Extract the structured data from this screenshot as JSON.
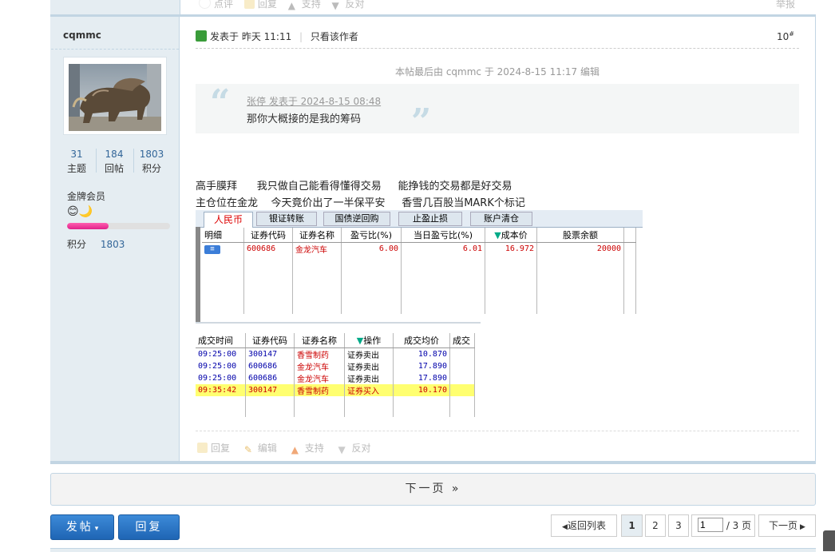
{
  "prev_post": {
    "actions": [
      "点评",
      "回复",
      "支持",
      "反对"
    ],
    "report": "举报"
  },
  "user": {
    "name": "cqmmc",
    "stats": [
      {
        "value": "31",
        "label": "主题"
      },
      {
        "value": "184",
        "label": "回帖"
      },
      {
        "value": "1803",
        "label": "积分"
      }
    ],
    "rank": "金牌会员",
    "rank_icons": "😊🌙",
    "score_label": "积分",
    "score_value": "1803",
    "score_progress": 0.4
  },
  "post": {
    "posted_label": "发表于 昨天 11:11",
    "only_author": "只看该作者",
    "floor": "10",
    "floor_sup": "#",
    "edit_note": "本帖最后由 cqmmc 于 2024-8-15 11:17 编辑",
    "quote_author": "张停 发表于 2024-8-15 08:48",
    "quote_text": "那你大概接的是我的筹码",
    "line1": "高手膜拜      我只做自己能看得懂得交易     能挣钱的交易都是好交易",
    "line2": "主仓位在金龙    今天竟价出了一半保平安     香雪几百股当MARK个标记",
    "actions": [
      "回复",
      "编辑",
      "支持",
      "反对"
    ]
  },
  "screenshot": {
    "tabs": [
      "人民币",
      "银证转账",
      "国债逆回购",
      "止盈止损",
      "账户清仓"
    ],
    "holdings_headers": [
      "明细",
      "证券代码",
      "证券名称",
      "盈亏比(%)",
      "当日盈亏比(%)",
      "成本价",
      "股票余额"
    ],
    "holdings_rows": [
      [
        "",
        "600686",
        "金龙汽车",
        "6.00",
        "6.01",
        "16.972",
        "20000"
      ]
    ],
    "trades_headers": [
      "成交时间",
      "证券代码",
      "证券名称",
      "操作",
      "成交均价",
      "成交"
    ],
    "trades_rows": [
      [
        "09:25:00",
        "300147",
        "香雪制药",
        "证券卖出",
        "10.870"
      ],
      [
        "09:25:00",
        "600686",
        "金龙汽车",
        "证券卖出",
        "17.890"
      ],
      [
        "09:25:00",
        "600686",
        "金龙汽车",
        "证券卖出",
        "17.890"
      ],
      [
        "09:35:42",
        "300147",
        "香雪制药",
        "证券买入",
        "10.170"
      ]
    ]
  },
  "next_page": "下一页 »",
  "buttons": {
    "post": "发帖",
    "reply": "回复"
  },
  "pagination": {
    "back": "返回列表",
    "pages": [
      "1",
      "2",
      "3"
    ],
    "current_input": "1",
    "total": "/ 3 页",
    "next": "下一页"
  }
}
